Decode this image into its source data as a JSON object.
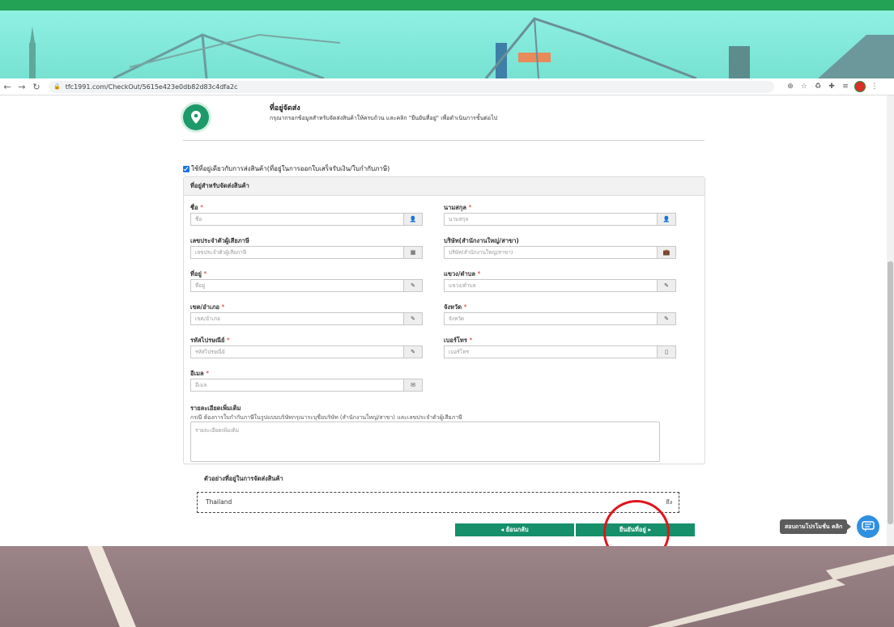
{
  "browser": {
    "url": "tfc1991.com/CheckOut/5615e423e0db82d83c4dfa2c"
  },
  "step": {
    "title": "ที่อยู่จัดส่ง",
    "subtitle": "กรุณากรอกข้อมูลสำหรับจัดส่งสินค้าให้ครบถ้วน และคลิก \"ยืนยันที่อยู่\" เพื่อดำเนินการขั้นต่อไป"
  },
  "same_address_checkbox": {
    "checked": true,
    "label": "ใช้ที่อยู่เดียวกับการส่งสินค้า(ที่อยู่ในการออกใบเสร็จรับเงิน/ใบกำกับภาษี)"
  },
  "panel": {
    "title": "ที่อยู่สำหรับจัดส่งสินค้า",
    "fields": {
      "first_name": {
        "label": "ชื่อ",
        "required": "*",
        "placeholder": "ชื่อ",
        "icon": "user-icon"
      },
      "last_name": {
        "label": "นามสกุล",
        "required": "*",
        "placeholder": "นามสกุล",
        "icon": "user-icon"
      },
      "tax_id": {
        "label": "เลขประจำตัวผู้เสียภาษี",
        "required": "",
        "placeholder": "เลขประจำตัวผู้เสียภาษี",
        "icon": "calculator-icon"
      },
      "company": {
        "label": "บริษัท(สำนักงานใหญ่/สาขา)",
        "required": "",
        "placeholder": "บริษัท(สำนักงานใหญ่/สาขา)",
        "icon": "briefcase-icon"
      },
      "address": {
        "label": "ที่อยู่",
        "required": "*",
        "placeholder": "ที่อยู่",
        "icon": "edit-icon"
      },
      "subdistrict": {
        "label": "แขวง/ตำบล",
        "required": "*",
        "placeholder": "แขวง/ตำบล",
        "icon": "edit-icon"
      },
      "district": {
        "label": "เขต/อำเภอ",
        "required": "*",
        "placeholder": "เขต/อำเภอ",
        "icon": "edit-icon"
      },
      "province": {
        "label": "จังหวัด",
        "required": "*",
        "placeholder": "จังหวัด",
        "icon": "edit-icon"
      },
      "postcode": {
        "label": "รหัสไปรษณีย์",
        "required": "*",
        "placeholder": "รหัสไปรษณีย์",
        "icon": "edit-icon"
      },
      "phone": {
        "label": "เบอร์โทร",
        "required": "*",
        "placeholder": "เบอร์โทร",
        "icon": "mobile-icon"
      },
      "email": {
        "label": "อีเมล",
        "required": "*",
        "placeholder": "อีเมล",
        "icon": "envelope-icon"
      }
    },
    "details": {
      "label": "รายละเอียดเพิ่มเติม",
      "note": "กรณี ต้องการใบกำกับภาษีในรูปแบบบริษัทกรุณาระบุชื่อบริษัท (สำนักงานใหญ่/สาขา) และเลขประจำตัวผู้เสียภาษี",
      "placeholder": "รายละเอียดเพิ่มเติม"
    }
  },
  "example": {
    "label": "ตัวอย่างที่อยู่ในการจัดส่งสินค้า",
    "country": "Thailand",
    "to": "ถึง"
  },
  "buttons": {
    "back": "◂ ย้อนกลับ",
    "confirm": "ยืนยันที่อยู่ ▸"
  },
  "chat": {
    "label": "สอบถามโปรโมชั่น คลิก"
  },
  "colors": {
    "accent": "#16906a",
    "stripe": "#23a155",
    "highlight": "#e0141c",
    "chat": "#2f8fe0"
  }
}
